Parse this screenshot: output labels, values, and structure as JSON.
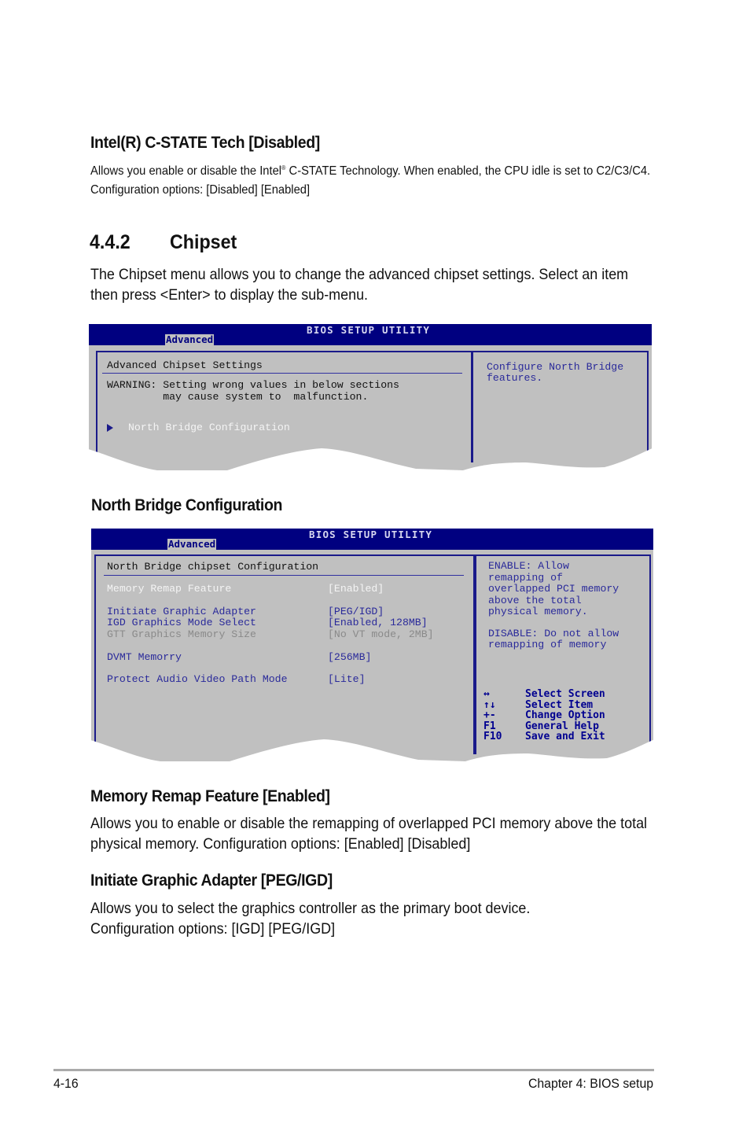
{
  "sections": {
    "cstate": {
      "heading": "Intel(R) C-STATE Tech [Disabled]",
      "body_pre": "Allows you enable or disable the Intel",
      "body_sup": "®",
      "body_post": " C-STATE Technology. When enabled, the CPU idle is set to C2/C3/C4. Configuration options: [Disabled] [Enabled]"
    },
    "chipset": {
      "number": "4.4.2",
      "title": "Chipset",
      "body": "The Chipset menu allows you to change the advanced chipset settings. Select an item then press <Enter> to display the sub-menu."
    },
    "northbridge": {
      "heading": "North Bridge Configuration"
    },
    "memory_remap": {
      "heading": "Memory Remap Feature [Enabled]",
      "body": "Allows you to enable or disable the  remapping of overlapped PCI memory above the total physical memory. Configuration options: [Enabled] [Disabled]"
    },
    "graphic_adapter": {
      "heading": "Initiate Graphic Adapter [PEG/IGD]",
      "body": "Allows you to select the graphics controller as the primary boot device. Configuration options: [IGD] [PEG/IGD]"
    }
  },
  "bios1": {
    "title": "BIOS SETUP UTILITY",
    "tab": "Advanced",
    "panel_title": "Advanced Chipset Settings",
    "warning_line1": "WARNING: Setting wrong values in below sections",
    "warning_line2": "         may cause system to  malfunction.",
    "submenu_item": "North Bridge Configuration",
    "help_line1": "Configure North Bridge",
    "help_line2": "features."
  },
  "bios2": {
    "title": "BIOS SETUP UTILITY",
    "tab": "Advanced",
    "panel_title": "North Bridge chipset Configuration",
    "settings": [
      {
        "label": "Memory Remap Feature",
        "value": "[Enabled]",
        "state": "selected"
      },
      {
        "label": "Initiate Graphic Adapter",
        "value": "[PEG/IGD]",
        "state": "normal"
      },
      {
        "label": "IGD Graphics Mode Select",
        "value": "[Enabled, 128MB]",
        "state": "normal"
      },
      {
        "label": "GTT Graphics Memory Size",
        "value": "[No VT mode, 2MB]",
        "state": "disabled"
      },
      {
        "label": "DVMT Memorry",
        "value": "[256MB]",
        "state": "normal"
      },
      {
        "label": "Protect Audio Video Path Mode",
        "value": "[Lite]",
        "state": "normal"
      }
    ],
    "help": [
      "ENABLE: Allow",
      "remapping of",
      "overlapped PCI memory",
      "above the total",
      "physical memory.",
      "",
      "DISABLE: Do not allow",
      "remapping of memory"
    ],
    "keys": [
      {
        "key": "↔",
        "action": "Select Screen"
      },
      {
        "key": "↑↓",
        "action": "Select Item"
      },
      {
        "key": "+-",
        "action": "Change Option"
      },
      {
        "key": "F1",
        "action": "General Help"
      },
      {
        "key": "F10",
        "action": "Save and Exit"
      }
    ]
  },
  "footer": {
    "page": "4-16",
    "chapter": "Chapter 4: BIOS setup"
  }
}
